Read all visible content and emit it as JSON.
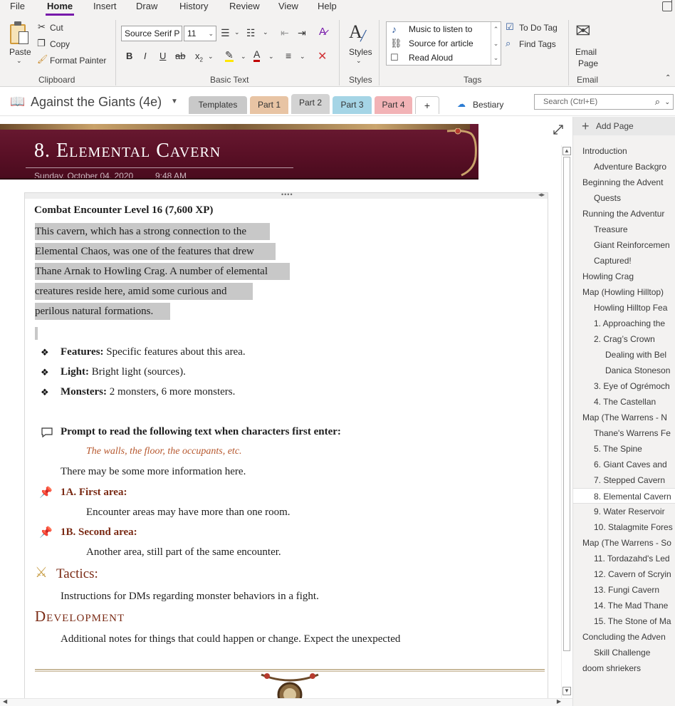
{
  "menu": {
    "tabs": [
      "File",
      "Home",
      "Insert",
      "Draw",
      "History",
      "Review",
      "View",
      "Help"
    ]
  },
  "ribbon": {
    "clipboard": {
      "paste": "Paste",
      "cut": "Cut",
      "copy": "Copy",
      "format_painter": "Format Painter",
      "label": "Clipboard"
    },
    "basic_text": {
      "font": "Source Serif P",
      "size": "11",
      "label": "Basic Text"
    },
    "styles": {
      "button": "Styles",
      "label": "Styles"
    },
    "tags": {
      "items": [
        "Music to listen to",
        "Source for article",
        "Read Aloud"
      ],
      "todo": "To Do Tag",
      "find": "Find Tags",
      "label": "Tags"
    },
    "email": {
      "line1": "Email",
      "line2": "Page",
      "label": "Email"
    }
  },
  "notebook": {
    "title": "Against the Giants (4e)",
    "sections": [
      {
        "label": "Templates",
        "color": "#c9c9c9"
      },
      {
        "label": "Part 1",
        "color": "#e8c4a4"
      },
      {
        "label": "Part 2",
        "color": "#d3d3d3"
      },
      {
        "label": "Part 3",
        "color": "#a5d5e6"
      },
      {
        "label": "Part 4",
        "color": "#f2b3b6"
      }
    ],
    "add_section": "+",
    "bestiary": "Bestiary",
    "search_placeholder": "Search (Ctrl+E)"
  },
  "page": {
    "title": "8. Elemental Cavern",
    "date": "Sunday, October 04, 2020",
    "time": "9:48 AM",
    "encounter": "Combat Encounter Level 16 (7,600 XP)",
    "intro_lines": [
      "This cavern, which has a strong connection to the",
      "Elemental Chaos, was one of the features that drew",
      "Thane Arnak to Howling Crag. A number of elemental",
      "creatures reside here, amid some curious and",
      "perilous natural formations."
    ],
    "bullets": [
      {
        "label": "Features:",
        "text": "Specific features about this area."
      },
      {
        "label": "Light:",
        "text": "Bright light (sources)."
      },
      {
        "label": "Monsters:",
        "text": "2 monsters, 6 more monsters."
      }
    ],
    "prompt_label": "Prompt to read the following text when characters first enter:",
    "prompt_text": "The walls, the floor, the occupants, etc.",
    "more_info": "There may be some more information here.",
    "area_1a_title": "1A. First area:",
    "area_1a_text": "Encounter areas may have more than one room.",
    "area_1b_title": "1B. Second area:",
    "area_1b_text": "Another area, still part of the same encounter.",
    "tactics_title": "Tactics:",
    "tactics_text": "Instructions for DMs regarding monster behaviors in a fight.",
    "development_title": "Development",
    "development_text": "Additional notes for things that could happen or change. Expect the unexpected"
  },
  "pages_pane": {
    "add_page": "Add Page",
    "items": [
      {
        "label": "Introduction",
        "indent": 0
      },
      {
        "label": "Adventure Backgro",
        "indent": 1
      },
      {
        "label": "Beginning the Advent",
        "indent": 0
      },
      {
        "label": "Quests",
        "indent": 1
      },
      {
        "label": "Running the Adventur",
        "indent": 0
      },
      {
        "label": "Treasure",
        "indent": 1
      },
      {
        "label": "Giant Reinforcemen",
        "indent": 1
      },
      {
        "label": "Captured!",
        "indent": 1
      },
      {
        "label": "Howling Crag",
        "indent": 0
      },
      {
        "label": "Map (Howling Hilltop)",
        "indent": 0
      },
      {
        "label": "Howling Hilltop Fea",
        "indent": 1
      },
      {
        "label": "1. Approaching the",
        "indent": 1
      },
      {
        "label": "2. Crag’s Crown",
        "indent": 1
      },
      {
        "label": "Dealing with Bel",
        "indent": 2
      },
      {
        "label": "Danica Stoneson",
        "indent": 2
      },
      {
        "label": "3. Eye of Ogrémoch",
        "indent": 1
      },
      {
        "label": "4. The Castellan",
        "indent": 1
      },
      {
        "label": "Map (The Warrens - N",
        "indent": 0
      },
      {
        "label": "Thane's Warrens Fe",
        "indent": 1
      },
      {
        "label": "5. The Spine",
        "indent": 1
      },
      {
        "label": "6. Giant Caves and",
        "indent": 1
      },
      {
        "label": "7. Stepped Cavern",
        "indent": 1
      },
      {
        "label": "8. Elemental Cavern",
        "indent": 1,
        "active": true
      },
      {
        "label": "9. Water Reservoir",
        "indent": 1
      },
      {
        "label": "10. Stalagmite Fores",
        "indent": 1
      },
      {
        "label": "Map (The Warrens - So",
        "indent": 0
      },
      {
        "label": "11. Tordazahd's Led",
        "indent": 1
      },
      {
        "label": "12. Cavern of Scryin",
        "indent": 1
      },
      {
        "label": "13. Fungi Cavern",
        "indent": 1
      },
      {
        "label": "14. The Mad Thane",
        "indent": 1
      },
      {
        "label": "15. The Stone of Ma",
        "indent": 1
      },
      {
        "label": "Concluding the Adven",
        "indent": 0
      },
      {
        "label": "Skill Challenge",
        "indent": 1
      },
      {
        "label": "doom shriekers",
        "indent": 0
      }
    ]
  }
}
